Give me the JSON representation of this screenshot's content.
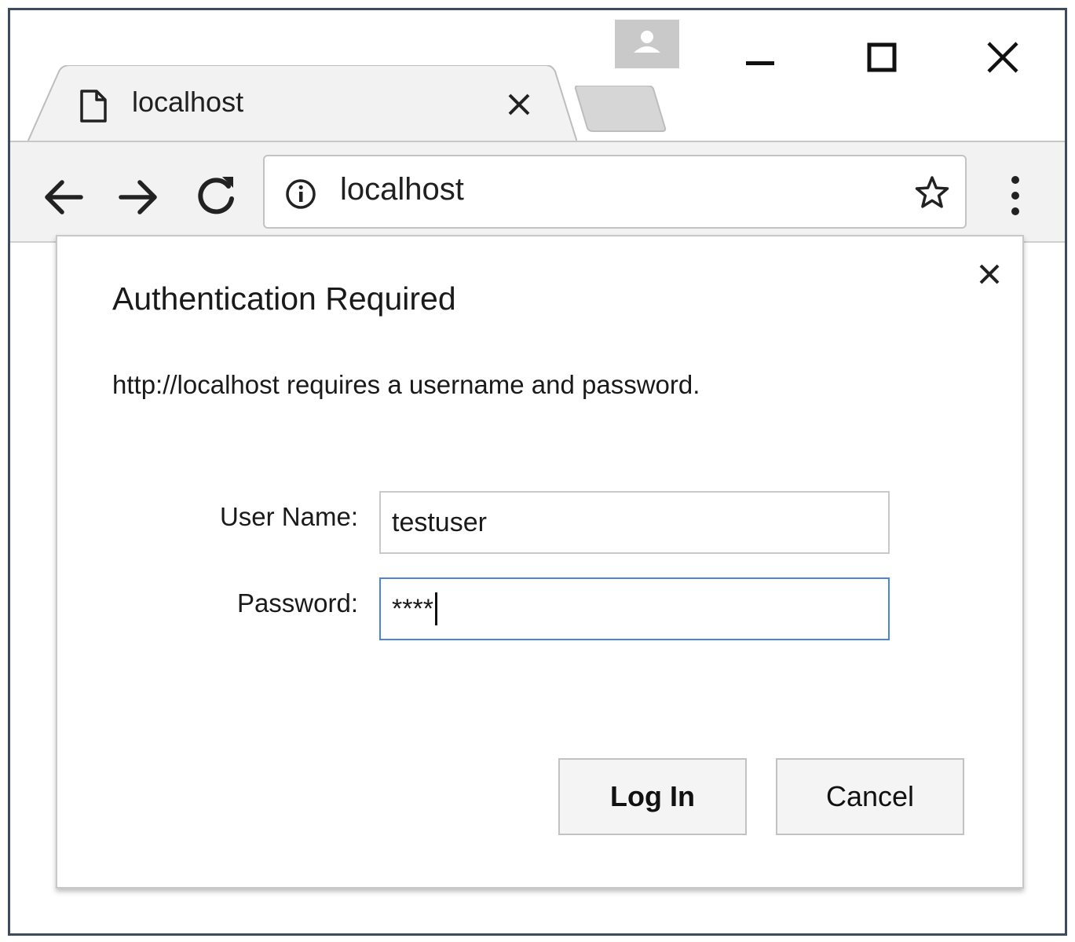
{
  "browser": {
    "tab": {
      "title": "localhost",
      "favicon": "page-icon",
      "close_icon": "close-icon"
    },
    "window_controls": {
      "minimize_icon": "minimize-icon",
      "maximize_icon": "maximize-icon",
      "close_icon": "close-icon",
      "profile_icon": "profile-icon"
    },
    "toolbar": {
      "back_icon": "arrow-left-icon",
      "forward_icon": "arrow-right-icon",
      "reload_icon": "reload-icon",
      "address": "localhost",
      "info_icon": "info-icon",
      "bookmark_icon": "star-icon",
      "menu_icon": "more-vert-icon"
    }
  },
  "dialog": {
    "title": "Authentication Required",
    "message": "http://localhost requires a username and password.",
    "username_label": "User Name:",
    "username_value": "testuser",
    "password_label": "Password:",
    "password_value": "****",
    "login_label": "Log In",
    "cancel_label": "Cancel",
    "close_icon": "close-icon"
  },
  "colors": {
    "focus_border": "#4a84dd",
    "window_border": "#3c4c5c",
    "toolbar_bg": "#f2f2f2"
  }
}
